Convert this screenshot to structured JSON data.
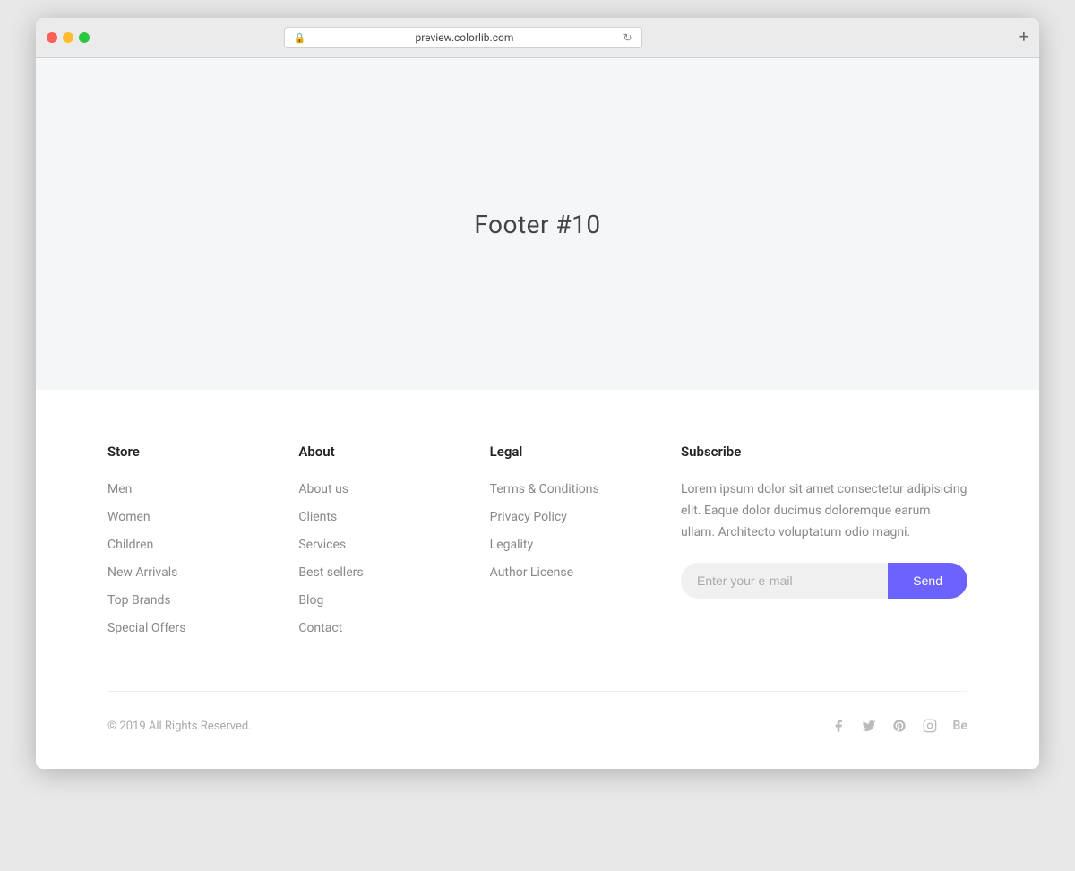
{
  "browser": {
    "url": "preview.colorlib.com",
    "tab_add_label": "+"
  },
  "hero": {
    "title": "Footer #10"
  },
  "footer": {
    "store": {
      "heading": "Store",
      "links": [
        {
          "label": "Men",
          "href": "#"
        },
        {
          "label": "Women",
          "href": "#"
        },
        {
          "label": "Children",
          "href": "#"
        },
        {
          "label": "New Arrivals",
          "href": "#"
        },
        {
          "label": "Top Brands",
          "href": "#"
        },
        {
          "label": "Special Offers",
          "href": "#"
        }
      ]
    },
    "about": {
      "heading": "About",
      "links": [
        {
          "label": "About us",
          "href": "#"
        },
        {
          "label": "Clients",
          "href": "#"
        },
        {
          "label": "Services",
          "href": "#"
        },
        {
          "label": "Best sellers",
          "href": "#"
        },
        {
          "label": "Blog",
          "href": "#"
        },
        {
          "label": "Contact",
          "href": "#"
        }
      ]
    },
    "legal": {
      "heading": "Legal",
      "links": [
        {
          "label": "Terms & Conditions",
          "href": "#"
        },
        {
          "label": "Privacy Policy",
          "href": "#"
        },
        {
          "label": "Legality",
          "href": "#"
        },
        {
          "label": "Author License",
          "href": "#"
        }
      ]
    },
    "subscribe": {
      "heading": "Subscribe",
      "description": "Lorem ipsum dolor sit amet consectetur adipisicing elit. Eaque dolor ducimus doloremque earum ullam. Architecto voluptatum odio magni.",
      "email_placeholder": "Enter your e-mail",
      "send_button_label": "Send"
    },
    "bottom": {
      "copyright": "© 2019 All Rights Reserved."
    }
  }
}
